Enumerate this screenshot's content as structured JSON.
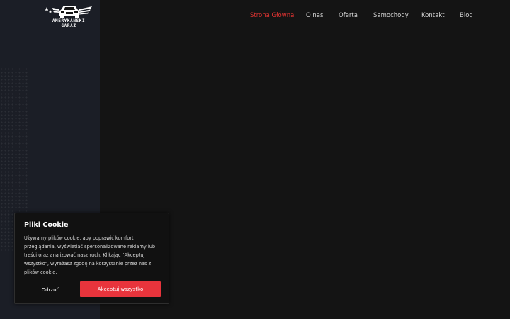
{
  "logo": {
    "line1": "AMERYKANSKI",
    "line2": "GARAZ",
    "icon": "car-with-stars-and-wings"
  },
  "nav": {
    "items": [
      {
        "label": "Strona Główna",
        "active": true
      },
      {
        "label": "O nas",
        "active": false
      },
      {
        "label": "Oferta",
        "active": false
      },
      {
        "label": "Samochody",
        "active": false
      },
      {
        "label": "Kontakt",
        "active": false
      },
      {
        "label": "Blog",
        "active": false
      }
    ]
  },
  "cookie": {
    "title": "Pliki Cookie",
    "text": "Używamy plików cookie, aby poprawić komfort przeglądania, wyświetlać spersonalizowane reklamy lub treści oraz analizować nasz ruch. Klikając \"Akceptuj wszystko\", wyrażasz zgodę na korzystanie przez nas z plików cookie.",
    "decline_label": "Odrzuć",
    "accept_label": "Akceptuj wszystko"
  },
  "colors": {
    "accent": "#e23432",
    "button_red": "#e8343c",
    "background": "#141414",
    "left_panel": "#1b1e26"
  }
}
